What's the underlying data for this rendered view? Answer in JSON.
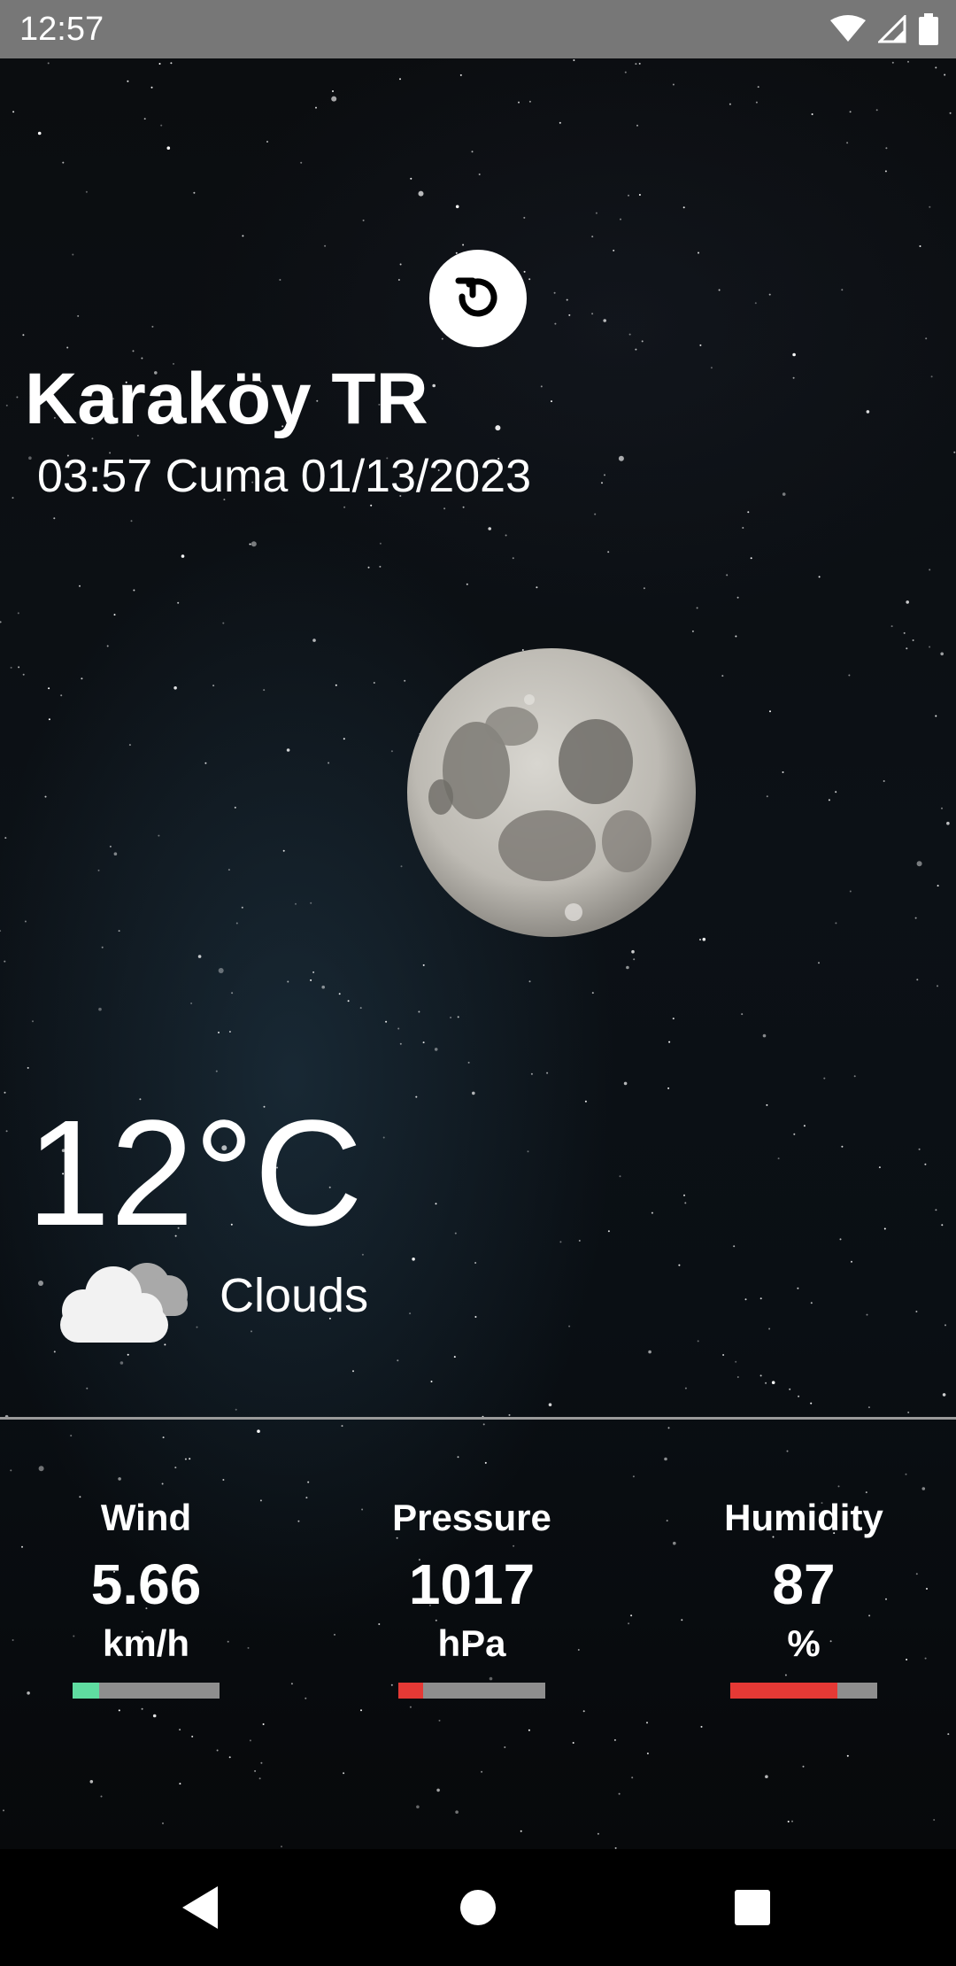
{
  "status_bar": {
    "time": "12:57"
  },
  "header": {
    "city": "Karaköy TR",
    "datetime": "03:57 Cuma 01/13/2023"
  },
  "weather": {
    "temperature": "12°C",
    "condition": "Clouds",
    "condition_icon": "clouds-icon"
  },
  "stats": {
    "wind": {
      "label": "Wind",
      "value": "5.66",
      "unit": "km/h",
      "level": 0.18,
      "color": "#5fdca0"
    },
    "pressure": {
      "label": "Pressure",
      "value": "1017",
      "unit": "hPa",
      "level": 0.17,
      "color": "#e53935"
    },
    "humidity": {
      "label": "Humidity",
      "value": "87",
      "unit": "%",
      "level": 0.73,
      "color": "#e53935"
    }
  },
  "colors": {
    "status_bar": "#777777",
    "text": "#ffffff",
    "bar_track": "#8e8e8e"
  }
}
